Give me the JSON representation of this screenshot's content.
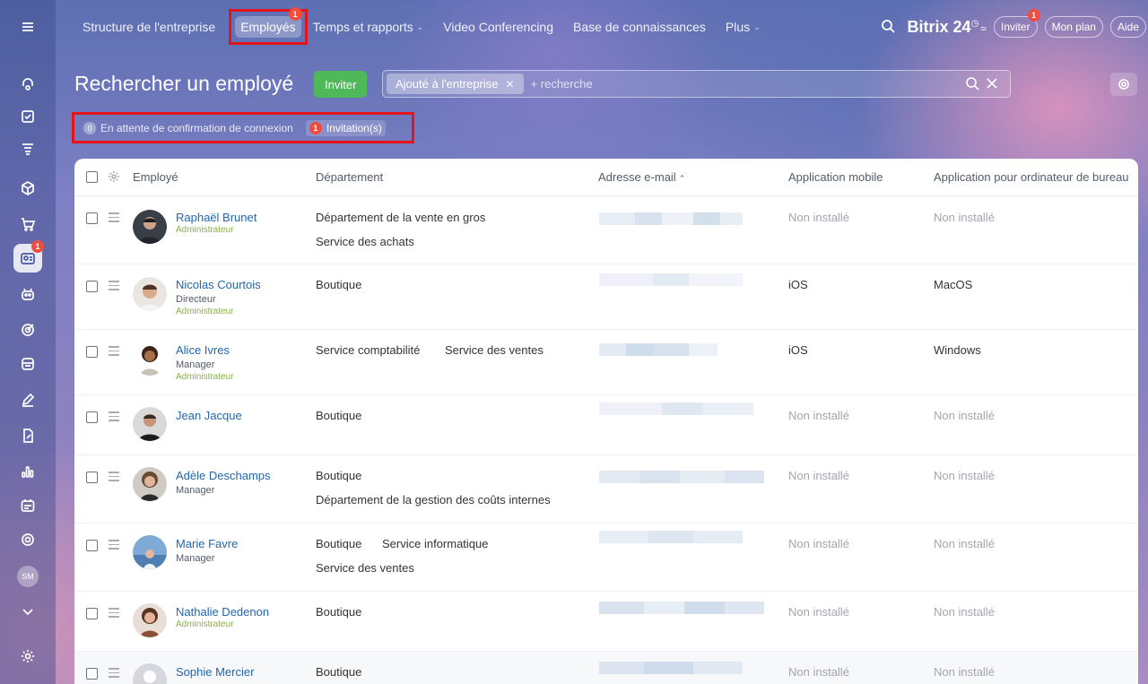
{
  "nav": {
    "items": [
      {
        "label": "Structure de l'entreprise"
      },
      {
        "label": "Employés",
        "badge": "1"
      },
      {
        "label": "Temps et rapports"
      },
      {
        "label": "Video Conferencing"
      },
      {
        "label": "Base de connaissances"
      },
      {
        "label": "Plus"
      }
    ],
    "brand": "Bitrix 24",
    "invite_label": "Inviter",
    "invite_badge": "1",
    "plan_label": "Mon plan",
    "help_label": "Aide"
  },
  "sidebar": {
    "badge": "1",
    "avatar_initials": "SM"
  },
  "page": {
    "title": "Rechercher un employé",
    "invite_button": "Inviter",
    "filter_chip": "Ajouté à l'entreprise",
    "filter_placeholder": "+ recherche",
    "status": {
      "pending_count": "0",
      "pending_label": "En attente de confirmation de connexion",
      "invitations_count": "1",
      "invitations_label": "Invitation(s)"
    }
  },
  "table": {
    "columns": {
      "employee": "Employé",
      "department": "Département",
      "email": "Adresse e-mail",
      "mobile": "Application mobile",
      "desktop": "Application pour ordinateur de bureau"
    },
    "rows": [
      {
        "name": "Raphaël Brunet",
        "position": "",
        "role": "Administrateur",
        "departments": [
          "Département de la vente en gros",
          "Service des achats"
        ],
        "mobile": "Non installé",
        "desktop": "Non installé"
      },
      {
        "name": "Nicolas Courtois",
        "position": "Directeur",
        "role": "Administrateur",
        "departments": [
          "Boutique"
        ],
        "mobile": "iOS",
        "desktop": "MacOS"
      },
      {
        "name": "Alice Ivres",
        "position": "Manager",
        "role": "Administrateur",
        "departments": [
          "Service comptabilité",
          "Service des ventes"
        ],
        "mobile": "iOS",
        "desktop": "Windows"
      },
      {
        "name": "Jean Jacque",
        "position": "",
        "role": "",
        "departments": [
          "Boutique"
        ],
        "mobile": "Non installé",
        "desktop": "Non installé"
      },
      {
        "name": "Adèle Deschamps",
        "position": "Manager",
        "role": "",
        "departments": [
          "Boutique",
          "Département de la gestion des coûts internes"
        ],
        "mobile": "Non installé",
        "desktop": "Non installé"
      },
      {
        "name": "Marie Favre",
        "position": "Manager",
        "role": "",
        "departments": [
          "Boutique",
          "Service informatique",
          "Service des ventes"
        ],
        "mobile": "Non installé",
        "desktop": "Non installé"
      },
      {
        "name": "Nathalie Dedenon",
        "position": "",
        "role": "Administrateur",
        "departments": [
          "Boutique"
        ],
        "mobile": "Non installé",
        "desktop": "Non installé"
      },
      {
        "name": "Sophie Mercier",
        "position": "",
        "role": "",
        "departments": [
          "Boutique"
        ],
        "mobile": "Non installé",
        "desktop": "Non installé"
      }
    ]
  },
  "colors": {
    "link": "#2067b0",
    "admin": "#8ab14a",
    "invite_green": "#4fb95a",
    "badge_red": "#f04d3f",
    "highlight_red": "#e3141b"
  }
}
